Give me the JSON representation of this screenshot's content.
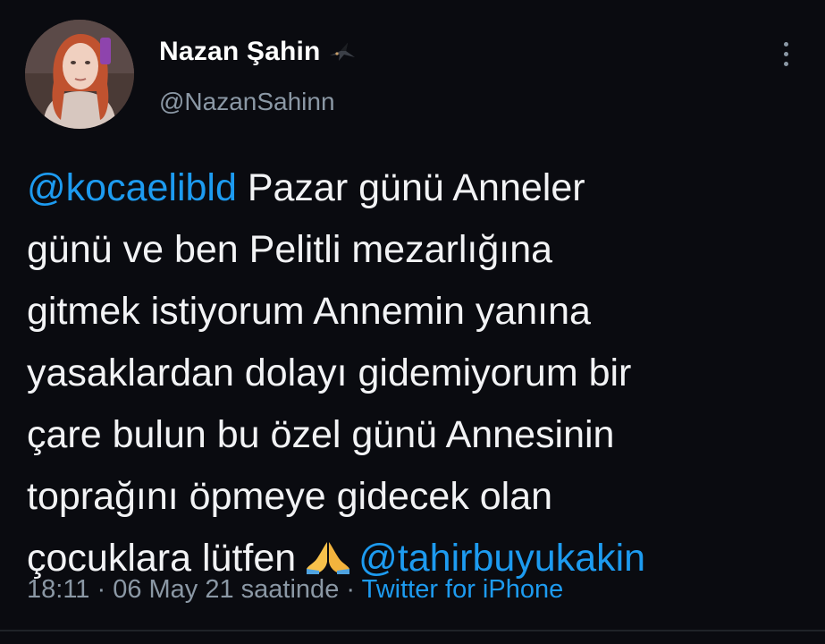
{
  "user": {
    "display_name": "Nazan Şahin",
    "handle": "@NazanSahinn",
    "name_emoji": "swallow-bird"
  },
  "tweet": {
    "line1_mention": "@kocaelibld",
    "line1_text": " Pazar günü Anneler",
    "line2": "günü ve ben Pelitli mezarlığına",
    "line3": "gitmek istiyorum Annemin yanına",
    "line4": "yasaklardan dolayı gidemiyorum bir",
    "line5": "çare bulun bu özel günü Annesinin",
    "line6": "toprağını öpmeye gidecek olan",
    "line7_text": "çocuklara lütfen",
    "line7_emoji": "folded-hands",
    "line7_mention": "@tahirbuyukakin"
  },
  "meta": {
    "time": "18:11",
    "sep1": " · ",
    "date": "06 May 21 saatinde",
    "sep2": " · ",
    "source": "Twitter for iPhone"
  },
  "colors": {
    "background": "#0a0b10",
    "link": "#1d9bf0",
    "secondary": "#8b98a5",
    "text": "#f2f3f5"
  },
  "icons": {
    "more": "more-vertical-icon"
  }
}
